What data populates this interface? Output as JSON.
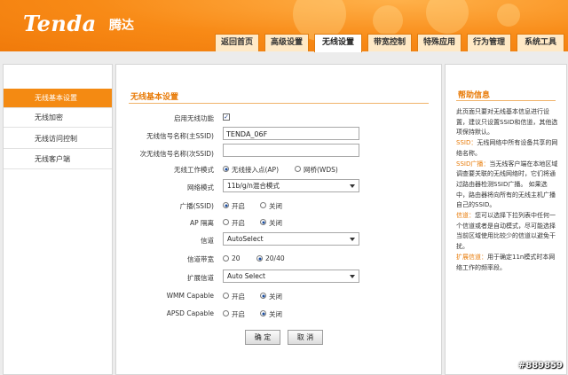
{
  "brand": {
    "logo": "Tenda",
    "logo_cn": "腾达"
  },
  "nav": {
    "tabs": [
      "返回首页",
      "高级设置",
      "无线设置",
      "带宽控制",
      "特殊应用",
      "行为管理",
      "系统工具"
    ],
    "active": "无线设置"
  },
  "sidebar": {
    "items": [
      {
        "label": "无线基本设置",
        "active": true
      },
      {
        "label": "无线加密",
        "active": false
      },
      {
        "label": "无线访问控制",
        "active": false
      },
      {
        "label": "无线客户端",
        "active": false
      }
    ]
  },
  "form": {
    "title": "无线基本设置",
    "enable_wireless": {
      "label": "启用无线功能",
      "checked": true,
      "mark": "✓"
    },
    "primary_ssid": {
      "label": "无线信号名称(主SSID)",
      "value": "TENDA_06F"
    },
    "secondary_ssid": {
      "label": "次无线信号名称(次SSID)",
      "value": ""
    },
    "mode": {
      "label": "无线工作模式",
      "option_ap": "无线接入点(AP)",
      "option_wds": "网桥(WDS)",
      "selected": "ap"
    },
    "network_mode": {
      "label": "网络模式",
      "value": "11b/g/n混合模式"
    },
    "broadcast": {
      "label": "广播(SSID)",
      "on": "开启",
      "off": "关闭",
      "selected": "on"
    },
    "ap_isolation": {
      "label": "AP 隔离",
      "on": "开启",
      "off": "关闭",
      "selected": "off"
    },
    "channel": {
      "label": "信道",
      "value": "AutoSelect"
    },
    "bandwidth": {
      "label": "信道带宽",
      "opt1": "20",
      "opt2": "20/40",
      "selected": "20/40"
    },
    "ext_channel": {
      "label": "扩展信道",
      "value": "Auto Select"
    },
    "wmm": {
      "label": "WMM Capable",
      "on": "开启",
      "off": "关闭",
      "selected": "off"
    },
    "apsd": {
      "label": "APSD Capable",
      "on": "开启",
      "off": "关闭",
      "selected": "off"
    },
    "ok_label": "确 定",
    "cancel_label": "取 消"
  },
  "help": {
    "title": "帮助信息",
    "intro": "此页面只要对无线基本信息进行设置，建议只设置SSID和信道，其他选项保持默认。",
    "ssid_key": "SSID：",
    "ssid_text": "无线网络中所有设备共享的网络名称。",
    "bcast_key": "SSID广播：",
    "bcast_text": "当无线客户端在本地区域调查要关联的无线网络时，它们将通过路由器检测SSID广播。 如果选中，路由器将向所有的无线主机广播自己的SSID。",
    "chan_key": "信道：",
    "chan_text": "您可以选择下拉列表中任何一个信道或者是自动模式，尽可能选择当前区域使用比较少的信道以避免干扰。",
    "ext_key": "扩展信道：",
    "ext_text": "用于确定11n模式时本网络工作的频率段。"
  },
  "watermark": "#889859",
  "colors": {
    "brand_orange": "#f48a12",
    "accent_text": "#e87b08"
  }
}
